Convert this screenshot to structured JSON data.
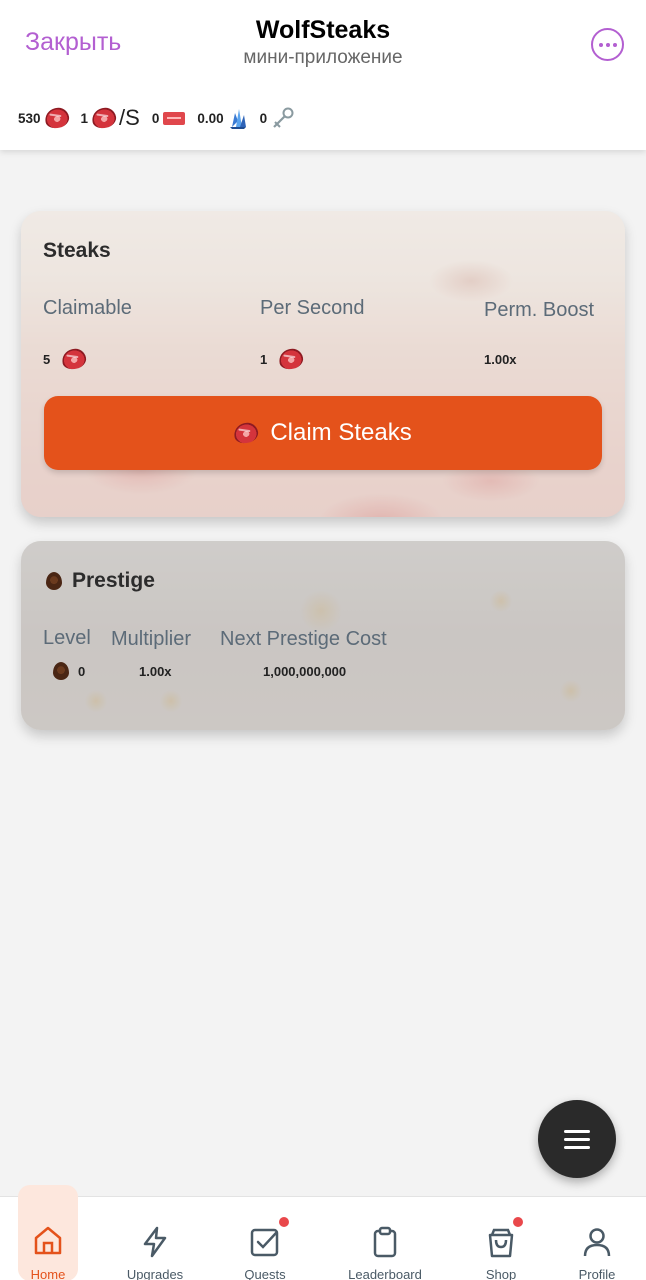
{
  "header": {
    "close_label": "Закрыть",
    "title": "WolfSteaks",
    "subtitle": "мини-приложение",
    "accent_color": "#b35fd1"
  },
  "resources": {
    "steaks": "530",
    "rate": "1",
    "rate_suffix": "/S",
    "tickets": "0",
    "crystals": "0.00",
    "keys": "0"
  },
  "steaks_card": {
    "title": "Steaks",
    "claimable_label": "Claimable",
    "claimable_value": "5",
    "per_second_label": "Per Second",
    "per_second_value": "1",
    "boost_label": "Perm. Boost",
    "boost_value": "1.00x",
    "claim_button": "Claim Steaks",
    "button_color": "#e4521b"
  },
  "prestige_card": {
    "title": "Prestige",
    "level_label": "Level",
    "level_value": "0",
    "multiplier_label": "Multiplier",
    "multiplier_value": "1.00x",
    "cost_label": "Next Prestige Cost",
    "cost_value": "1,000,000,000"
  },
  "nav": {
    "home": "Home",
    "upgrades": "Upgrades",
    "quests": "Quests",
    "leaderboard": "Leaderboard",
    "shop": "Shop",
    "profile": "Profile",
    "active": "home",
    "active_color": "#e4521b"
  }
}
